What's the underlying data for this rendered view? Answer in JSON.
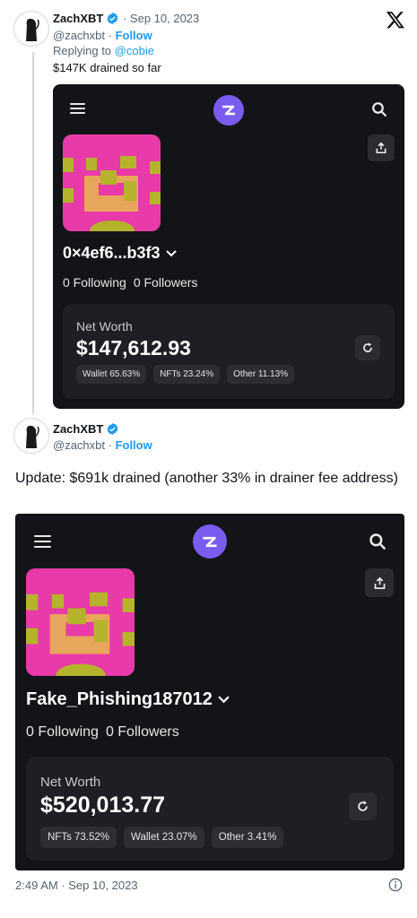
{
  "tweet1": {
    "author_name": "ZachXBT",
    "date": "Sep 10, 2023",
    "handle": "@zachxbt",
    "follow_label": "Follow",
    "replying_prefix": "Replying to",
    "replying_handle": "@cobie",
    "text": "$147K drained so far",
    "card": {
      "wallet_name": "0×4ef6...b3f3",
      "following": "0 Following",
      "followers": "0 Followers",
      "net_worth_label": "Net Worth",
      "net_worth_value": "$147,612.93",
      "chips": [
        "Wallet 65.63%",
        "NFTs 23.24%",
        "Other 11.13%"
      ]
    }
  },
  "tweet2": {
    "author_name": "ZachXBT",
    "handle": "@zachxbt",
    "follow_label": "Follow",
    "text": "Update: $691k drained (another 33% in drainer fee address)",
    "card": {
      "wallet_name": "Fake_Phishing187012",
      "following": "0 Following",
      "followers": "0 Followers",
      "net_worth_label": "Net Worth",
      "net_worth_value": "$520,013.77",
      "chips": [
        "NFTs 73.52%",
        "Wallet 23.07%",
        "Other 3.41%"
      ]
    },
    "timestamp": "2:49 AM · Sep 10, 2023"
  },
  "colors": {
    "card_bg": "#131418",
    "panel_bg": "#1e1f24",
    "accent_purple": "#7b5cf0",
    "nft_pink": "#e83aa8",
    "link_blue": "#1d9bf0"
  },
  "icons": [
    "x-logo-icon",
    "verified-icon",
    "menu-icon",
    "app-logo-icon",
    "search-icon",
    "share-icon",
    "chevron-down-icon",
    "refresh-icon",
    "info-icon"
  ]
}
